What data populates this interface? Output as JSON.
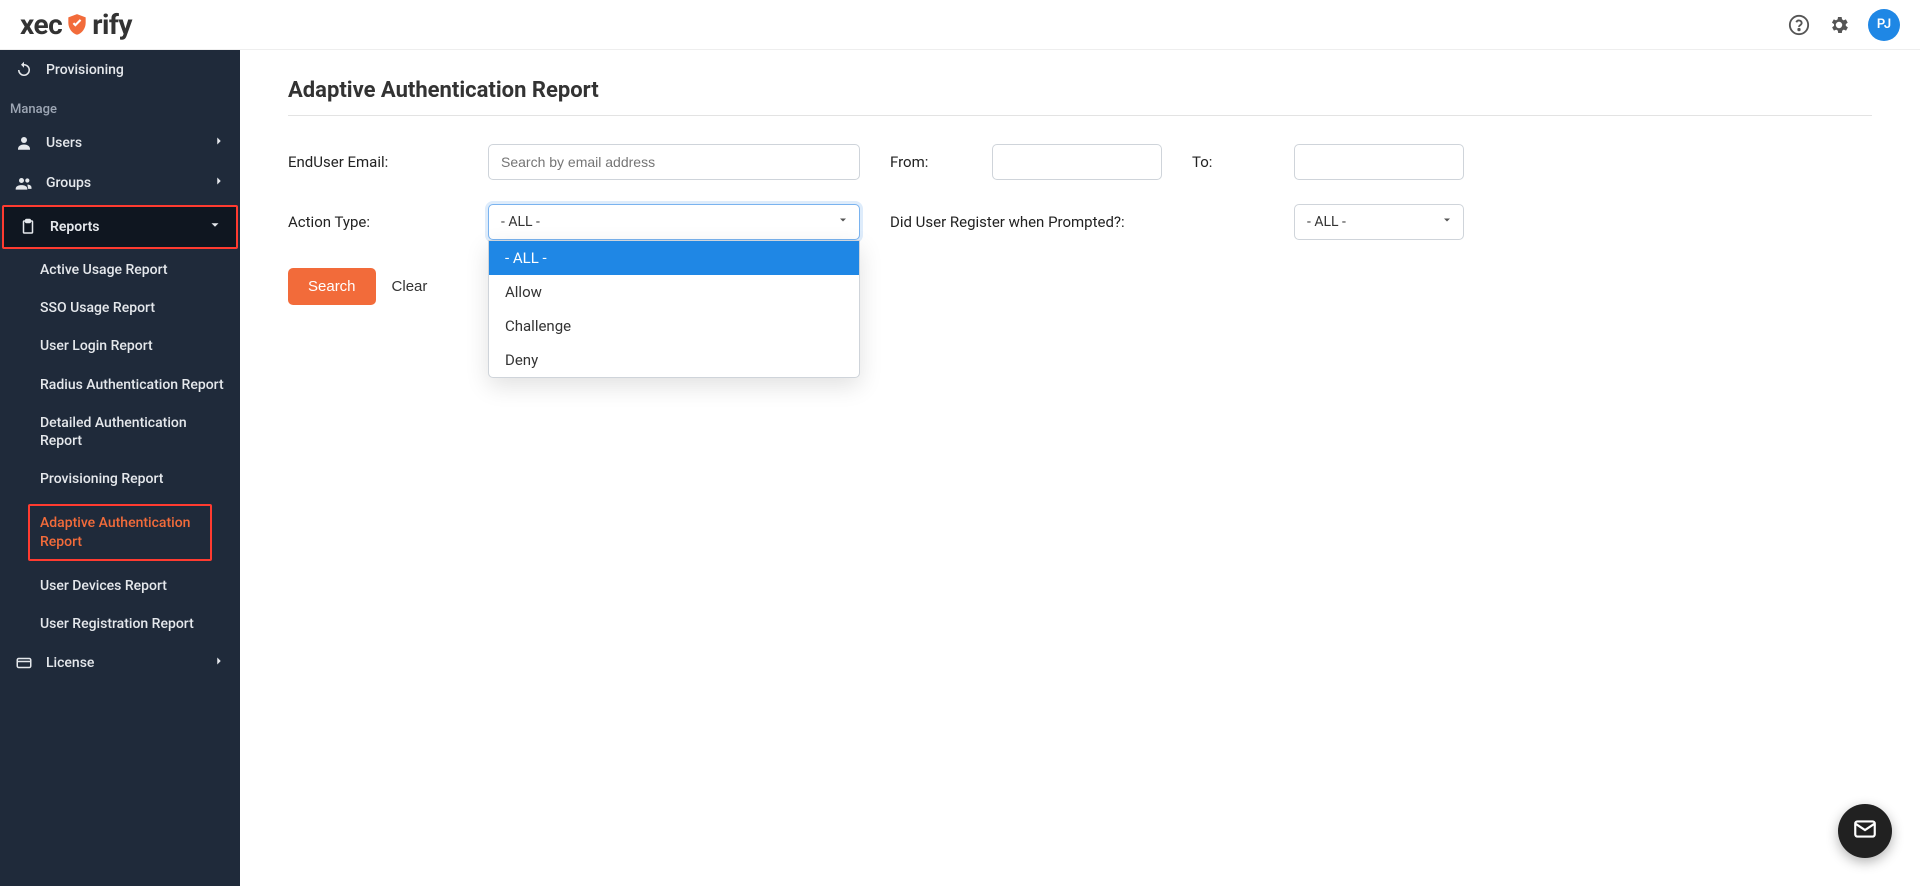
{
  "brand": {
    "name_pre": "xec",
    "name_post": "rify"
  },
  "topbar": {
    "avatar_initials": "PJ"
  },
  "sidebar": {
    "provisioning": "Provisioning",
    "manage_label": "Manage",
    "users": "Users",
    "groups": "Groups",
    "reports": "Reports",
    "license": "License",
    "report_items": [
      "Active Usage Report",
      "SSO Usage Report",
      "User Login Report",
      "Radius Authentication Report",
      "Detailed Authentication Report",
      "Provisioning Report",
      "Adaptive Authentication Report",
      "User Devices Report",
      "User Registration Report"
    ]
  },
  "page": {
    "title": "Adaptive Authentication Report",
    "filters": {
      "enduser_email_label": "EndUser Email:",
      "enduser_email_placeholder": "Search by email address",
      "from_label": "From:",
      "to_label": "To:",
      "action_type_label": "Action Type:",
      "action_type_selected": "- ALL -",
      "action_type_options": [
        "- ALL -",
        "Allow",
        "Challenge",
        "Deny"
      ],
      "register_prompt_label": "Did User Register when Prompted?:",
      "register_prompt_selected": "- ALL -"
    },
    "buttons": {
      "search": "Search",
      "clear": "Clear"
    }
  }
}
